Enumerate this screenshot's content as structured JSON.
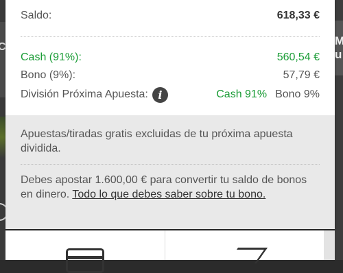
{
  "balance": {
    "saldo_label": "Saldo:",
    "saldo_value": "618,33 €",
    "cash_label": "Cash (91%):",
    "cash_value": "560,54 €",
    "bono_label": "Bono (9%):",
    "bono_value": "57,79 €",
    "division_label": "División Próxima Apuesta:",
    "division_cash": "Cash 91%",
    "division_bono": "Bono 9%"
  },
  "notes": {
    "excluded_text": "Apuestas/tiradas gratis excluidas de tu próxima apuesta dividida.",
    "wager_text": "Debes apostar 1.600,00 € para convertir tu saldo de bonos en dinero.",
    "link_text": "Todo lo que debes saber sobre tu bono."
  },
  "background": {
    "left_fragment": "C",
    "right_fragment_1": "M",
    "right_fragment_2": "u"
  },
  "colors": {
    "green": "#1a9c36",
    "panel_gray": "#e9e9e9"
  },
  "icons": [
    "info-icon",
    "card-icon",
    "shoe-icon"
  ]
}
